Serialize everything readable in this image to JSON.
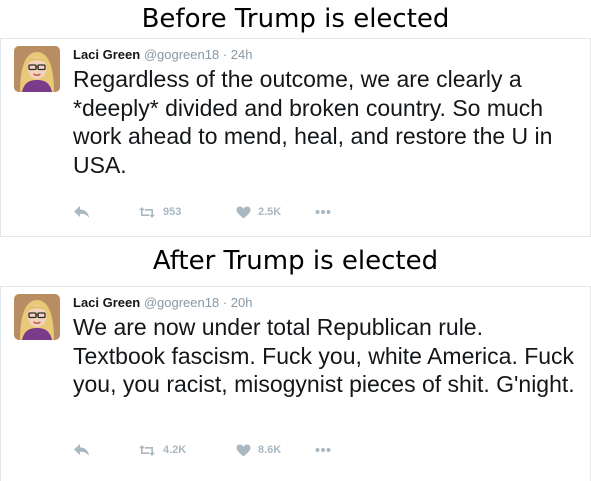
{
  "tweets": [
    {
      "heading": "Before Trump is elected",
      "name": "Laci Green",
      "handle": "@gogreen18",
      "separator": "·",
      "time": "24h",
      "text": "Regardless of the outcome, we are clearly a *deeply* divided and broken country. So much work ahead to mend, heal, and restore the U in USA.",
      "retweets": "953",
      "likes": "2.5K"
    },
    {
      "heading": "After Trump is elected",
      "name": "Laci Green",
      "handle": "@gogreen18",
      "separator": "·",
      "time": "20h",
      "text": "We are now under total Republican rule. Textbook fascism. Fuck you, white America. Fuck you, you racist, misogynist pieces of shit. G'night.",
      "retweets": "4.2K",
      "likes": "8.6K"
    }
  ],
  "icons": {
    "reply": "reply-icon",
    "retweet": "retweet-icon",
    "like": "heart-icon",
    "more": "more-dots-icon"
  },
  "colors": {
    "text": "#14171a",
    "muted": "#8899a6",
    "action": "#aab8c2",
    "border": "#e1e8ed"
  }
}
